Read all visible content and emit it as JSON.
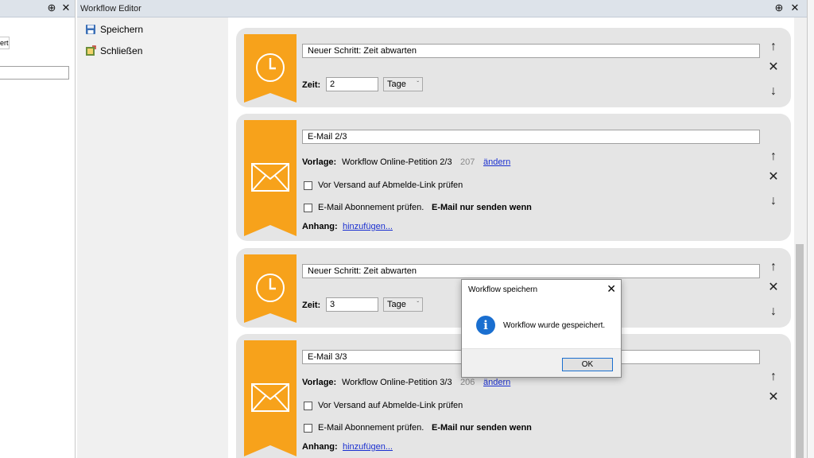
{
  "left_panel": {
    "pin": "⊕",
    "close": "✕",
    "tab_fragment": "ert",
    "input_value": ""
  },
  "editor": {
    "title": "Workflow Editor",
    "pin": "⊕",
    "close": "✕"
  },
  "commands": {
    "save_label": "Speichern",
    "close_label": "Schließen"
  },
  "steps": [
    {
      "type": "wait",
      "name": "Neuer Schritt: Zeit abwarten",
      "time_label": "Zeit:",
      "time_value": "2",
      "unit": "Tage"
    },
    {
      "type": "email",
      "name": "E-Mail 2/3",
      "template_label": "Vorlage:",
      "template_name": "Workflow Online-Petition 2/3",
      "template_id": "207",
      "change_link": "ändern",
      "check1": "Vor Versand auf Abmelde-Link prüfen",
      "check2_a": "E-Mail Abonnement prüfen.",
      "check2_b": "E-Mail nur senden wenn",
      "attachment_label": "Anhang:",
      "attachment_link": "hinzufügen..."
    },
    {
      "type": "wait",
      "name": "Neuer Schritt: Zeit abwarten",
      "time_label": "Zeit:",
      "time_value": "3",
      "unit": "Tage"
    },
    {
      "type": "email",
      "name": "E-Mail 3/3",
      "template_label": "Vorlage:",
      "template_name": "Workflow Online-Petition 3/3",
      "template_id": "206",
      "change_link": "ändern",
      "check1": "Vor Versand auf Abmelde-Link prüfen",
      "check2_a": "E-Mail Abonnement prüfen.",
      "check2_b": "E-Mail nur senden wenn",
      "attachment_label": "Anhang:",
      "attachment_link": "hinzufügen..."
    }
  ],
  "controls": {
    "up": "↑",
    "remove": "✕",
    "down": "↓",
    "dropdown": "ˇ"
  },
  "dialog": {
    "title": "Workflow speichern",
    "close": "✕",
    "info": "i",
    "message": "Workflow wurde gespeichert.",
    "ok": "OK"
  },
  "colors": {
    "ribbon": "#f7a21b",
    "accent": "#1a6fd0",
    "link": "#1a2fd0"
  },
  "icons": [
    "clock-icon",
    "envelope-icon",
    "save-icon",
    "close-doc-icon",
    "info-icon",
    "pin-icon"
  ]
}
